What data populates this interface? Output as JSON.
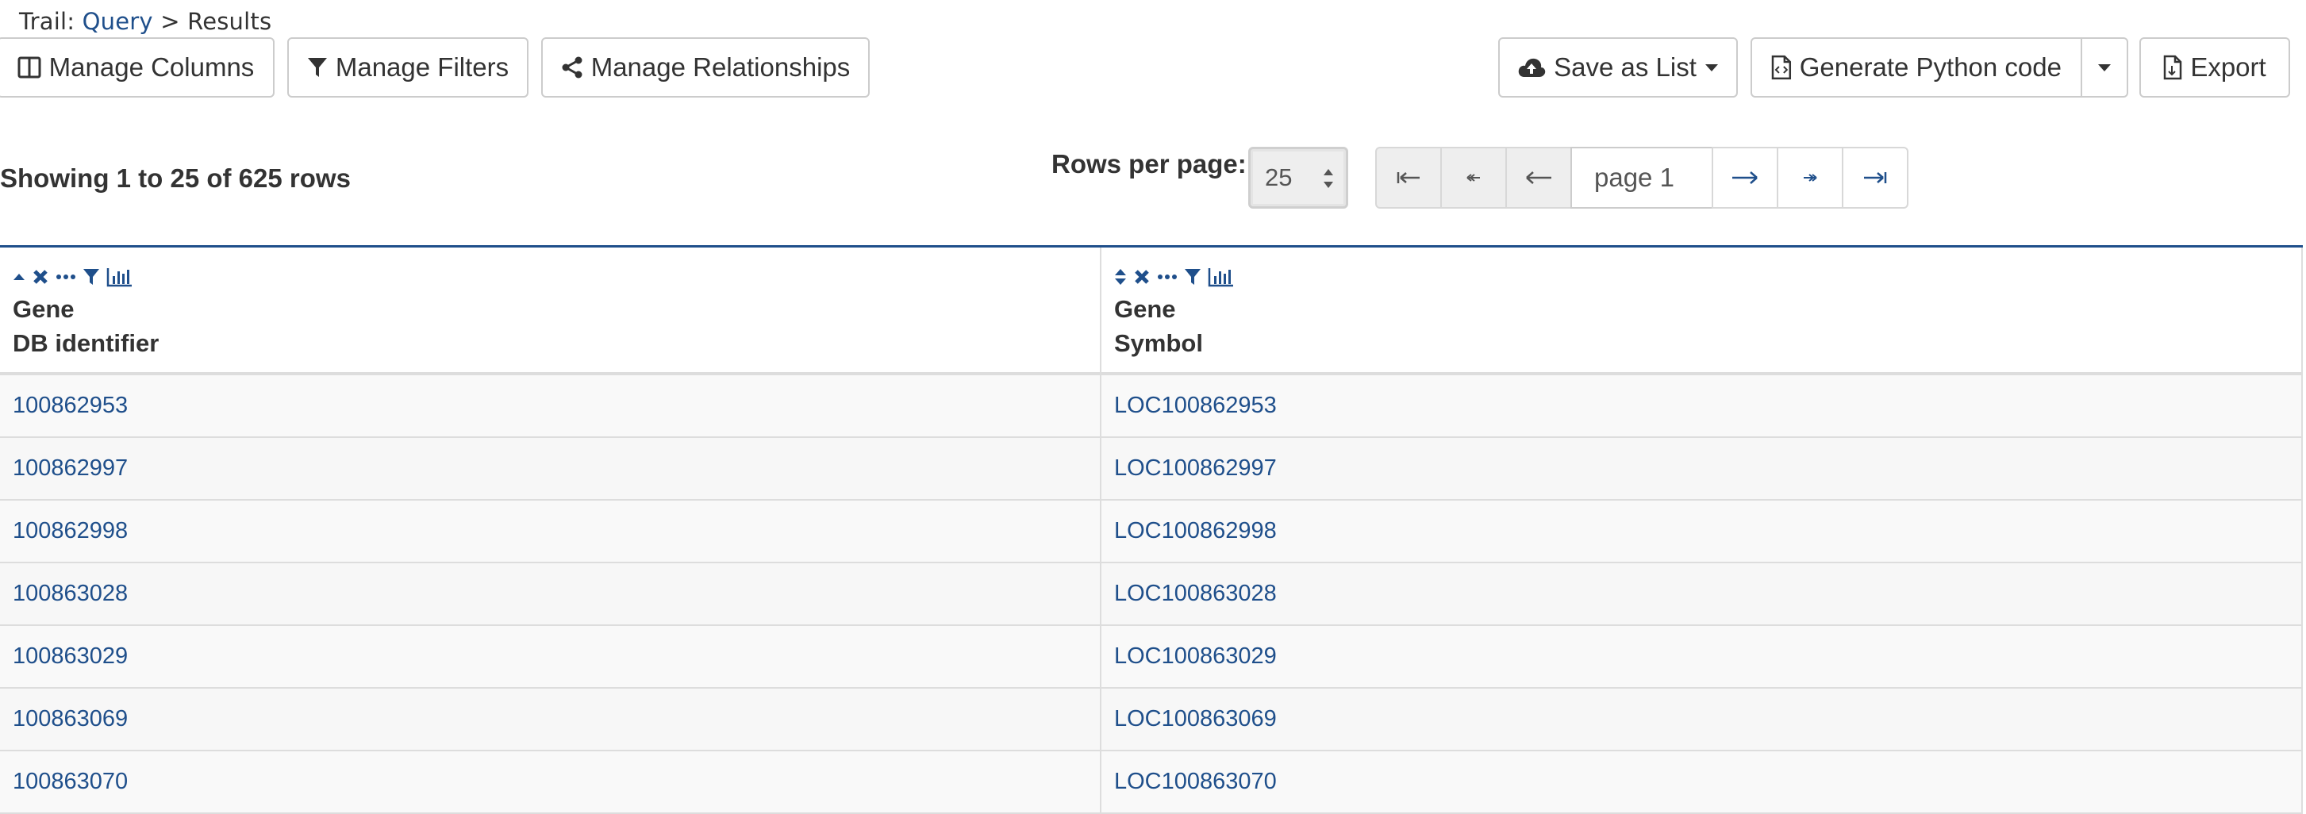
{
  "trail": {
    "prefix": "Trail:",
    "query_link": "Query",
    "separator": ">",
    "current": "Results"
  },
  "toolbar": {
    "manage_columns": "Manage Columns",
    "manage_filters": "Manage Filters",
    "manage_relationships": "Manage Relationships",
    "save_as_list": "Save as List",
    "generate_python": "Generate Python code",
    "export": "Export"
  },
  "status": {
    "showing": "Showing 1 to 25 of 625 rows"
  },
  "pagination": {
    "rows_per_page_label": "Rows per page:",
    "rows_per_page_value": "25",
    "page": "page 1"
  },
  "table": {
    "columns": [
      {
        "line1": "Gene",
        "line2": "DB identifier"
      },
      {
        "line1": "Gene",
        "line2": "Symbol"
      }
    ],
    "rows": [
      [
        "100862953",
        "LOC100862953"
      ],
      [
        "100862997",
        "LOC100862997"
      ],
      [
        "100862998",
        "LOC100862998"
      ],
      [
        "100863028",
        "LOC100863028"
      ],
      [
        "100863029",
        "LOC100863029"
      ],
      [
        "100863069",
        "LOC100863069"
      ],
      [
        "100863070",
        "LOC100863070"
      ]
    ]
  },
  "colors": {
    "link": "#1f4f8b",
    "accent_border": "#1f4f8b"
  }
}
